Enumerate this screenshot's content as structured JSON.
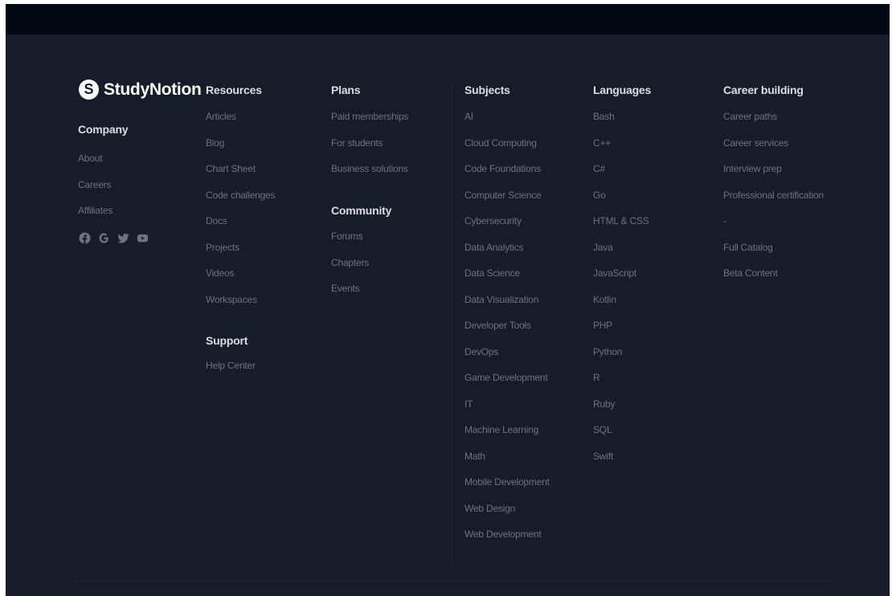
{
  "brand": {
    "logo_letter": "S",
    "name": "StudyNotion"
  },
  "company": {
    "heading": "Company",
    "links": [
      "About",
      "Careers",
      "Affiliates"
    ]
  },
  "socials": [
    "facebook-icon",
    "google-icon",
    "twitter-icon",
    "youtube-icon"
  ],
  "resources": {
    "heading": "Resources",
    "links": [
      "Articles",
      "Blog",
      "Chart Sheet",
      "Code challenges",
      "Docs",
      "Projects",
      "Videos",
      "Workspaces"
    ]
  },
  "support": {
    "heading": "Support",
    "links": [
      "Help Center"
    ]
  },
  "plans": {
    "heading": "Plans",
    "links": [
      "Paid memberships",
      "For students",
      "Business solutions"
    ]
  },
  "community": {
    "heading": "Community",
    "links": [
      "Forums",
      "Chapters",
      "Events"
    ]
  },
  "subjects": {
    "heading": "Subjects",
    "links": [
      "AI",
      "Cloud Computing",
      "Code Foundations",
      "Computer Science",
      "Cybersecurity",
      "Data Analytics",
      "Data Science",
      "Data Visualization",
      "Developer Tools",
      "DevOps",
      "Game Development",
      "IT",
      "Machine Learning",
      "Math",
      "Mobile Development",
      "Web Design",
      "Web Development"
    ]
  },
  "languages": {
    "heading": "Languages",
    "links": [
      "Bash",
      "C++",
      "C#",
      "Go",
      "HTML & CSS",
      "Java",
      "JavaScript",
      "Kotlin",
      "PHP",
      "Python",
      "R",
      "Ruby",
      "SQL",
      "Swift"
    ]
  },
  "career": {
    "heading": "Career building",
    "links": [
      "Career paths",
      "Career services",
      "Interview prep",
      "Professional certification",
      "-",
      "Full Catalog",
      "Beta Content"
    ]
  },
  "colors": {
    "background": "#161d29",
    "topbar": "#000814",
    "heading": "#dbdde3",
    "link": "#6e727f"
  }
}
